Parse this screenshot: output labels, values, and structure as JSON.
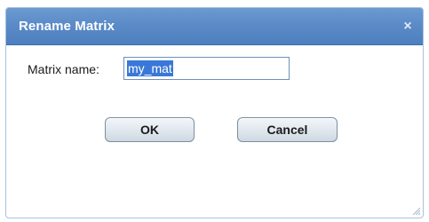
{
  "dialog": {
    "title": "Rename Matrix",
    "close_symbol": "×",
    "field_label": "Matrix name:",
    "input_value": "my_mat",
    "ok_label": "OK",
    "cancel_label": "Cancel"
  },
  "icons": {
    "close": "close-icon",
    "resize": "resize-grip-icon"
  },
  "colors": {
    "titlebar": "#5b8bc8",
    "selection": "#3a78d8"
  }
}
